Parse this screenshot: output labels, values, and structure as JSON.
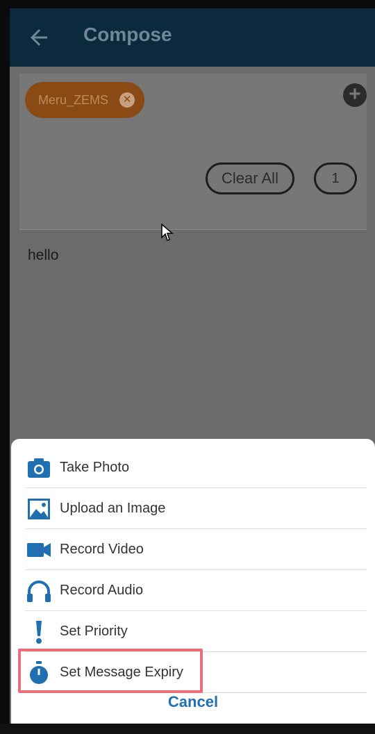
{
  "header": {
    "title": "Compose"
  },
  "recipients": {
    "chip_label": "Meru_ZEMS",
    "clear_all_label": "Clear All",
    "count": "1"
  },
  "message": {
    "text": "hello"
  },
  "sheet": {
    "items": [
      {
        "label": "Take Photo",
        "icon": "camera-icon"
      },
      {
        "label": "Upload an Image",
        "icon": "image-icon"
      },
      {
        "label": "Record Video",
        "icon": "video-camera-icon"
      },
      {
        "label": "Record Audio",
        "icon": "headphones-icon"
      },
      {
        "label": "Set Priority",
        "icon": "exclamation-icon"
      },
      {
        "label": "Set Message Expiry",
        "icon": "stopwatch-icon"
      }
    ],
    "cancel_label": "Cancel"
  },
  "colors": {
    "accent": "#1f6fb1",
    "highlight": "#ea6e7a",
    "chip": "#8a4a13"
  }
}
